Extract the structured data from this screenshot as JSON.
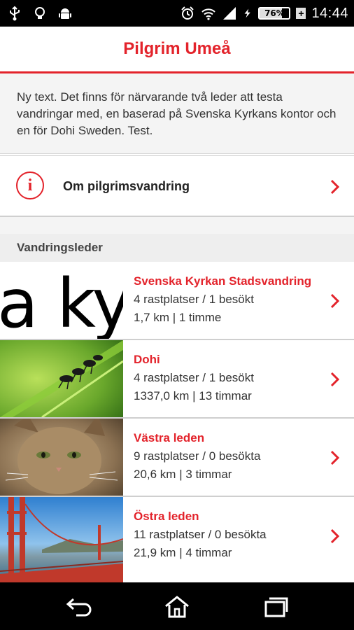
{
  "status_bar": {
    "icons_left": [
      "usb-icon",
      "lightbulb-icon",
      "android-icon"
    ],
    "icons_right": [
      "alarm-icon",
      "wifi-icon",
      "signal-icon",
      "charging-icon"
    ],
    "battery": "76%",
    "battery_level": 0.76,
    "time": "14:44"
  },
  "header": {
    "title": "Pilgrim Umeå"
  },
  "intro": {
    "text": "Ny text. Det finns för närvarande två leder att testa vandringar med, en baserad på Svenska Kyrkans kontor och en för Dohi Sweden. Test."
  },
  "info": {
    "label": "Om pilgrimsvandring",
    "icon": "info-icon"
  },
  "section": {
    "title": "Vandringsleder"
  },
  "trails": [
    {
      "name": "Svenska Kyrkan Stadsvandring",
      "stops": "4 rastplatser / 1 besökt",
      "distance": "1,7 km | 1 timme",
      "thumb_text": "a ky"
    },
    {
      "name": "Dohi",
      "stops": "4 rastplatser / 1 besökt",
      "distance": "1337,0 km | 13 timmar"
    },
    {
      "name": "Västra leden",
      "stops": "9 rastplatser / 0 besökta",
      "distance": "20,6 km | 3 timmar"
    },
    {
      "name": "Östra leden",
      "stops": "11 rastplatser / 0 besökta",
      "distance": "21,9 km | 4 timmar"
    }
  ],
  "nav": [
    "back-icon",
    "home-icon",
    "recent-apps-icon"
  ],
  "colors": {
    "accent": "#e3232b",
    "status_bar": "#000000",
    "nav_bar": "#000000"
  }
}
